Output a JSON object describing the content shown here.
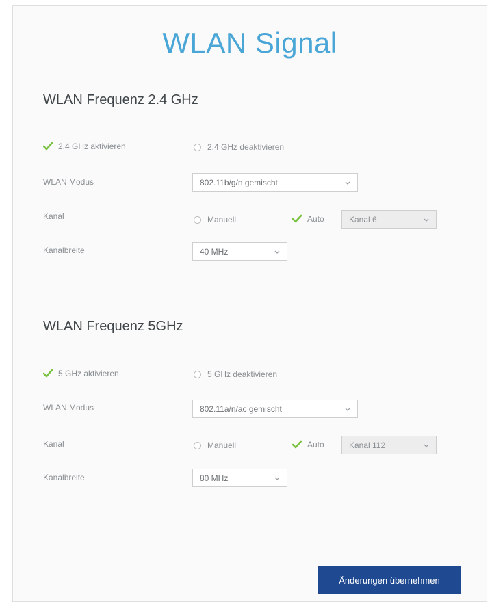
{
  "page": {
    "title": "WLAN Signal"
  },
  "band24": {
    "section_title": "WLAN Frequenz 2.4 GHz",
    "enable_label": "2.4 GHz aktivieren",
    "disable_label": "2.4 GHz deaktivieren",
    "enabled": true,
    "mode_label": "WLAN Modus",
    "mode_value": "802.11b/g/n gemischt",
    "channel_label": "Kanal",
    "manual_label": "Manuell",
    "auto_label": "Auto",
    "channel_mode": "auto",
    "channel_value": "Kanal 6",
    "width_label": "Kanalbreite",
    "width_value": "40 MHz"
  },
  "band5": {
    "section_title": "WLAN Frequenz 5GHz",
    "enable_label": "5 GHz aktivieren",
    "disable_label": "5 GHz deaktivieren",
    "enabled": true,
    "mode_label": "WLAN Modus",
    "mode_value": "802.11a/n/ac gemischt",
    "channel_label": "Kanal",
    "manual_label": "Manuell",
    "auto_label": "Auto",
    "channel_mode": "auto",
    "channel_value": "Kanal 112",
    "width_label": "Kanalbreite",
    "width_value": "80 MHz"
  },
  "footer": {
    "apply_label": "Änderungen übernehmen"
  },
  "colors": {
    "accent_title": "#4aa6d6",
    "check_green": "#7cc242",
    "button_blue": "#1f4a92"
  },
  "icons": {
    "checked": "check-icon",
    "unchecked": "radio-empty-icon",
    "dropdown": "chevron-down-icon"
  }
}
